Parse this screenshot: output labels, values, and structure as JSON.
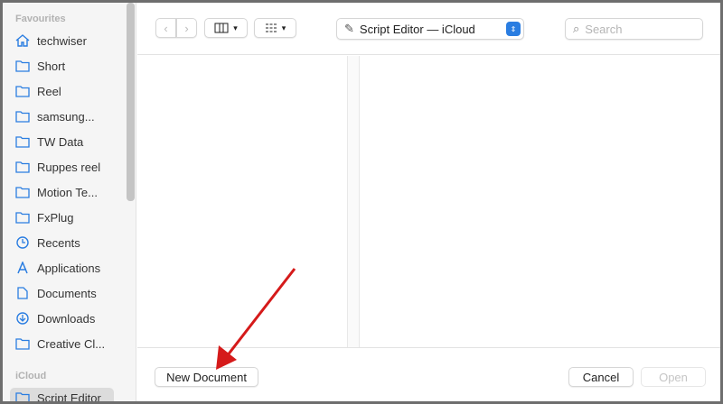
{
  "sidebar": {
    "favourites_label": "Favourites",
    "items": [
      {
        "label": "techwiser",
        "icon": "home-icon"
      },
      {
        "label": "Short",
        "icon": "folder-icon"
      },
      {
        "label": "Reel",
        "icon": "folder-icon"
      },
      {
        "label": "samsung...",
        "icon": "folder-icon"
      },
      {
        "label": "TW Data",
        "icon": "folder-icon"
      },
      {
        "label": "Ruppes reel",
        "icon": "folder-icon"
      },
      {
        "label": "Motion Te...",
        "icon": "folder-icon"
      },
      {
        "label": "FxPlug",
        "icon": "folder-icon"
      },
      {
        "label": "Recents",
        "icon": "clock-icon"
      },
      {
        "label": "Applications",
        "icon": "applications-icon"
      },
      {
        "label": "Documents",
        "icon": "document-icon"
      },
      {
        "label": "Downloads",
        "icon": "download-icon"
      },
      {
        "label": "Creative Cl...",
        "icon": "folder-icon"
      }
    ],
    "icloud_label": "iCloud",
    "icloud_item": "Script Editor"
  },
  "toolbar": {
    "location": "Script Editor — iCloud",
    "search_placeholder": "Search"
  },
  "bottom": {
    "new_document": "New Document",
    "cancel": "Cancel",
    "open": "Open"
  },
  "accent": "#2a7de1"
}
